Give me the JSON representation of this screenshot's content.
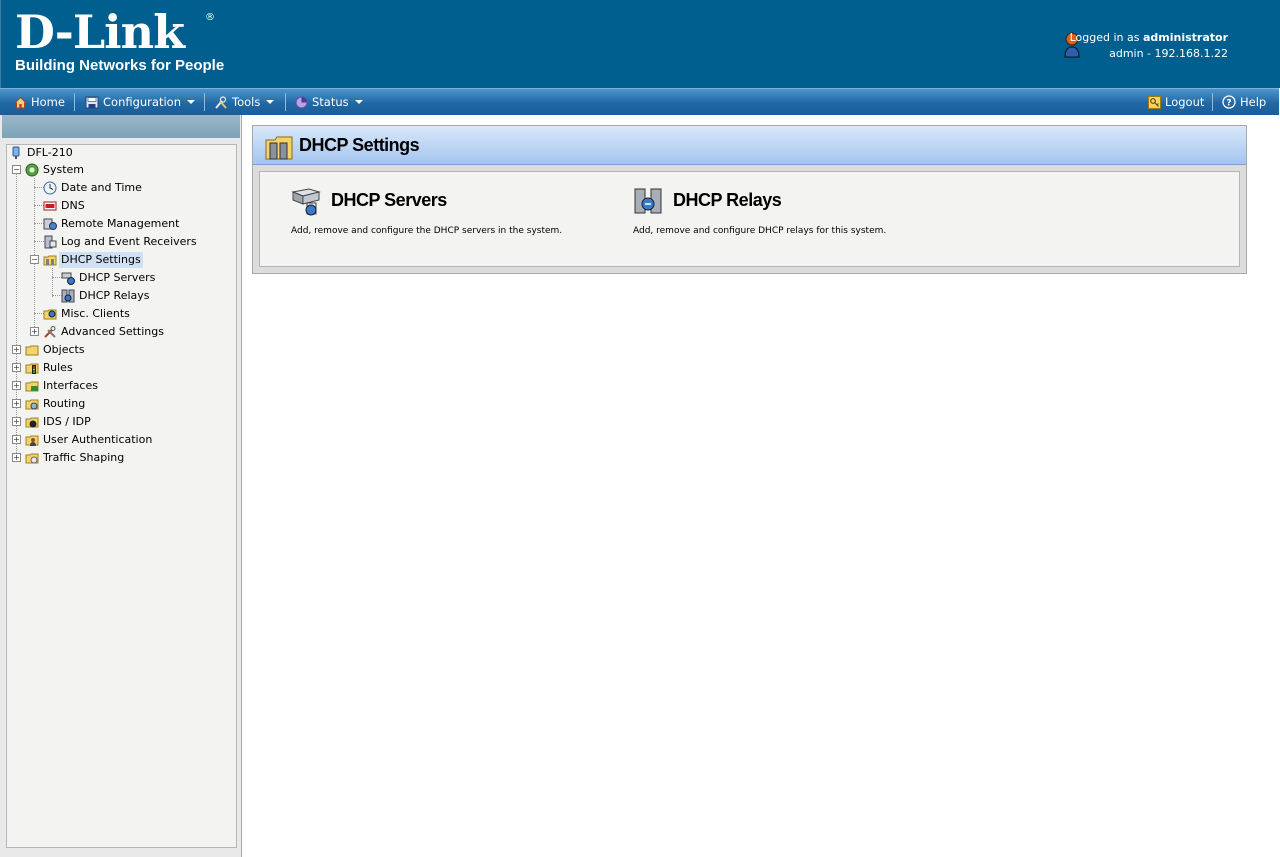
{
  "header": {
    "logo_main": "D-Link",
    "logo_reg": "®",
    "logo_tagline": "Building Networks for People",
    "logged_in_prefix": "Logged in as ",
    "logged_in_user": "administrator",
    "session": "admin - 192.168.1.22"
  },
  "menu": {
    "home": "Home",
    "configuration": "Configuration",
    "tools": "Tools",
    "status": "Status",
    "logout": "Logout",
    "help": "Help"
  },
  "tree": {
    "root": "DFL-210",
    "system": "System",
    "date_time": "Date and Time",
    "dns": "DNS",
    "remote_mgmt": "Remote Management",
    "log_receivers": "Log and Event Receivers",
    "dhcp_settings": "DHCP Settings",
    "dhcp_servers": "DHCP Servers",
    "dhcp_relays": "DHCP Relays",
    "misc_clients": "Misc. Clients",
    "advanced": "Advanced Settings",
    "objects": "Objects",
    "rules": "Rules",
    "interfaces": "Interfaces",
    "routing": "Routing",
    "ids_idp": "IDS / IDP",
    "user_auth": "User Authentication",
    "traffic_shaping": "Traffic Shaping"
  },
  "main": {
    "title": "DHCP Settings",
    "cards": [
      {
        "title": "DHCP Servers",
        "desc": "Add, remove and configure the DHCP servers in the system."
      },
      {
        "title": "DHCP Relays",
        "desc": "Add, remove and configure DHCP relays for this system."
      }
    ]
  },
  "colors": {
    "header_bg": "#005f8e",
    "menubar": "#1f68a5",
    "selection": "#cfe0f3",
    "panel_head": "#a4c5ef"
  }
}
